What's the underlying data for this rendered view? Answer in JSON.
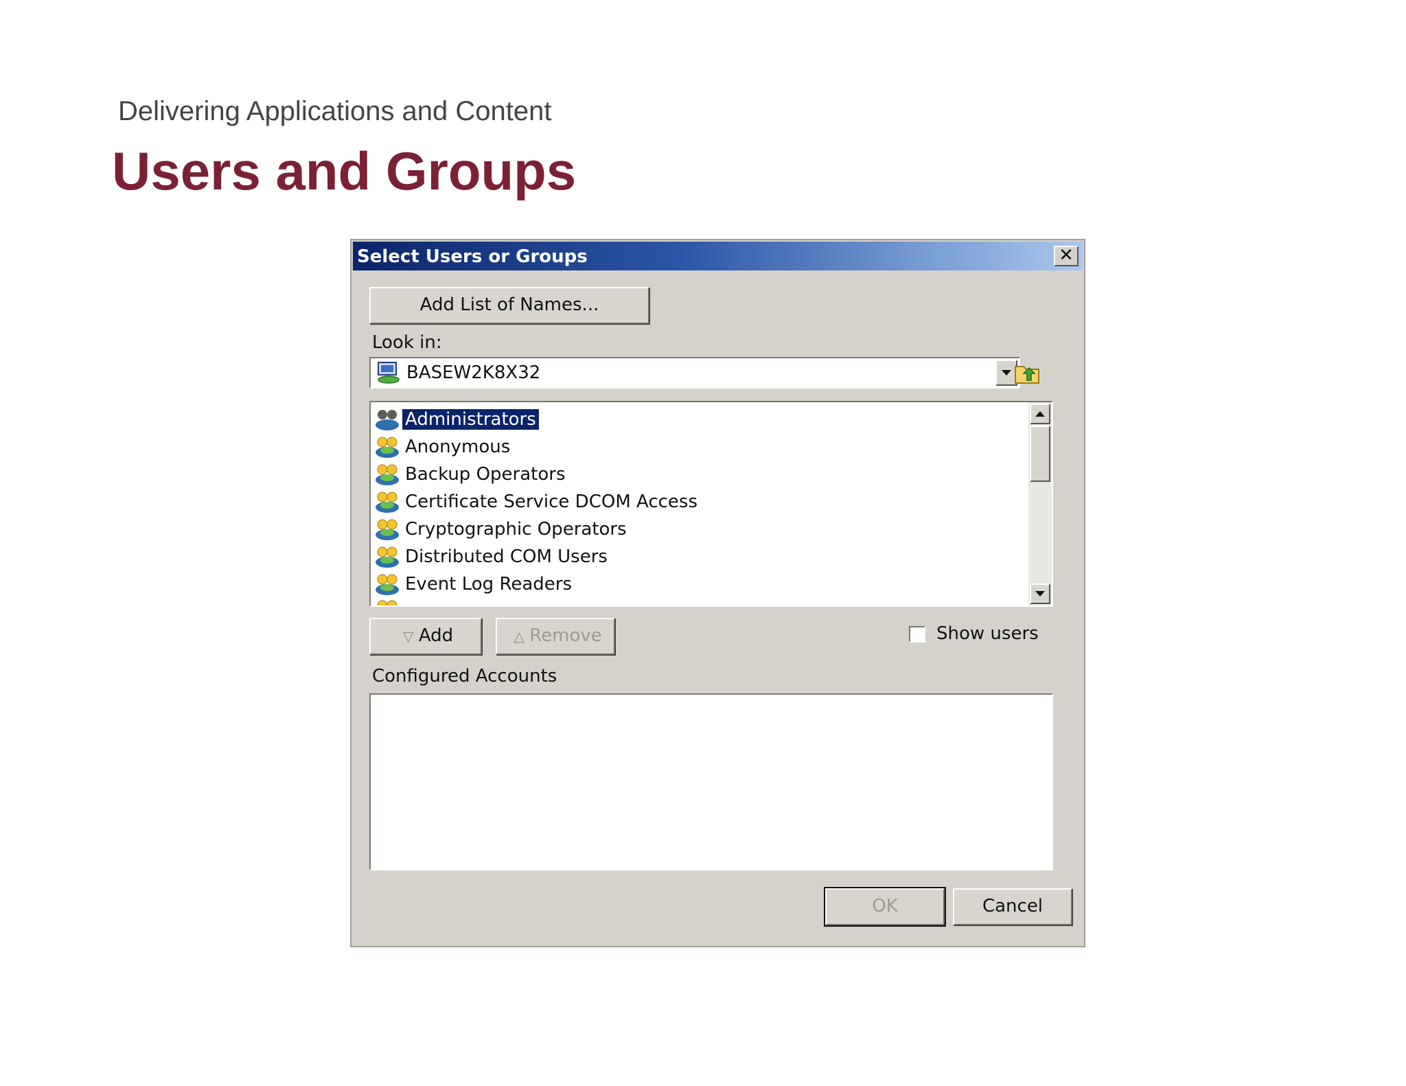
{
  "slide": {
    "subtitle": "Delivering Applications and Content",
    "title": "Users and Groups"
  },
  "dialog": {
    "title": "Select Users or Groups",
    "close_glyph": "✕",
    "add_list_button": "Add List of Names...",
    "look_in_label": "Look in:",
    "look_in_value": "BASEW2K8X32",
    "groups": [
      {
        "label": "Administrators",
        "selected": true
      },
      {
        "label": "Anonymous",
        "selected": false
      },
      {
        "label": "Backup Operators",
        "selected": false
      },
      {
        "label": "Certificate Service DCOM Access",
        "selected": false
      },
      {
        "label": "Cryptographic Operators",
        "selected": false
      },
      {
        "label": "Distributed COM Users",
        "selected": false
      },
      {
        "label": "Event Log Readers",
        "selected": false
      }
    ],
    "add_button": "Add",
    "remove_button": "Remove",
    "show_users_label": "Show users",
    "show_users_checked": false,
    "configured_accounts_label": "Configured Accounts",
    "ok_button": "OK",
    "cancel_button": "Cancel"
  },
  "colors": {
    "title_accent": "#7b2136",
    "selection": "#0b2469",
    "dialog_face": "#d5d2cb"
  }
}
